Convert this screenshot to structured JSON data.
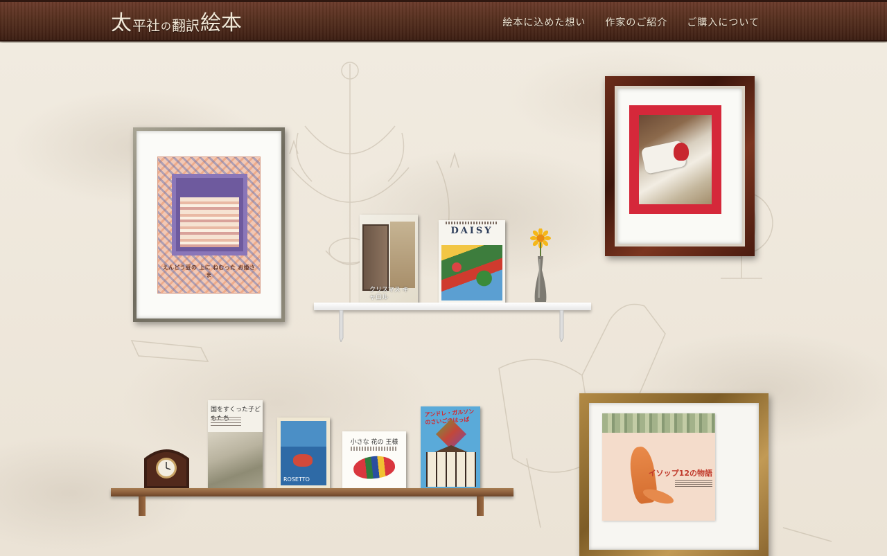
{
  "header": {
    "logo": {
      "c1": "太",
      "c2": "平社",
      "c3": "の",
      "c4": "翻訳",
      "c5": "絵本"
    },
    "nav": [
      {
        "label": "絵本に込めた想い"
      },
      {
        "label": "作家のご紹介"
      },
      {
        "label": "ご購入について"
      }
    ]
  },
  "frames": {
    "princess": {
      "title": "えんどう豆の 上に ねむった お姫さま"
    },
    "fox": {
      "title": "イソップ12の物語"
    }
  },
  "books": {
    "carol": {
      "title": "クリスマス キャロル"
    },
    "daisy": {
      "title": "DAISY"
    },
    "children": {
      "title": "国をすくった子どもたち"
    },
    "rosetto": {
      "title": "ROSETTO"
    },
    "flower": {
      "title": "小さな 花の 王様"
    },
    "lastleaf": {
      "title": "アンドレ・ガルソンのさいごのはっぱ"
    }
  },
  "colors": {
    "header": "#57301f",
    "wall": "#ece4d6",
    "nav_text": "#efe5d3"
  }
}
